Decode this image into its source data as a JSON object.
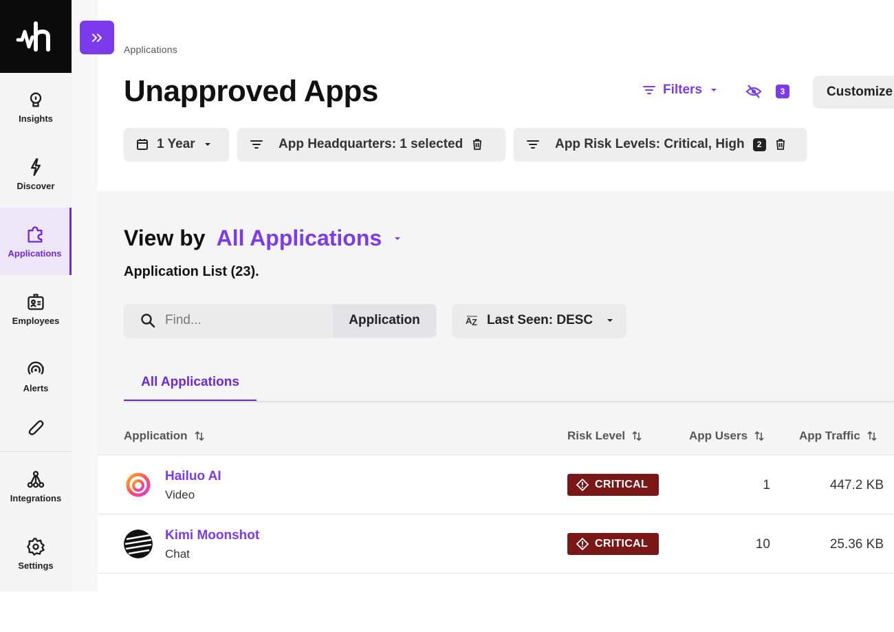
{
  "sidebar": {
    "items": [
      {
        "label": "Insights",
        "icon": "lightbulb-icon"
      },
      {
        "label": "Discover",
        "icon": "lightning-icon"
      },
      {
        "label": "Applications",
        "icon": "puzzle-icon",
        "active": true
      },
      {
        "label": "Employees",
        "icon": "id-badge-icon"
      },
      {
        "label": "Alerts",
        "icon": "broadcast-alert-icon"
      },
      {
        "label": "",
        "icon": "paperclip-icon"
      },
      {
        "label": "Integrations",
        "icon": "network-icon"
      },
      {
        "label": "Settings",
        "icon": "gear-icon"
      }
    ]
  },
  "header": {
    "breadcrumb": "Applications",
    "title": "Unapproved Apps",
    "filters_label": "Filters",
    "hidden_count": "3",
    "customize_label": "Customize"
  },
  "chips": [
    {
      "label": "1 Year"
    },
    {
      "label": "App Headquarters: 1 selected"
    },
    {
      "label": "App Risk Levels: Critical, High",
      "count": "2"
    }
  ],
  "content": {
    "view_by_label": "View by",
    "view_by_value": "All Applications",
    "list_count": "Application List (23).",
    "search_placeholder": "Find...",
    "search_scope": "Application",
    "sort_label": "Last Seen: DESC",
    "tab": "All Applications"
  },
  "table": {
    "columns": [
      "Application",
      "Risk Level",
      "App Users",
      "App Traffic"
    ],
    "rows": [
      {
        "name": "Hailuo AI",
        "category": "Video",
        "risk": "CRITICAL",
        "users": "1",
        "traffic": "447.2 KB"
      },
      {
        "name": "Kimi Moonshot",
        "category": "Chat",
        "risk": "CRITICAL",
        "users": "10",
        "traffic": "25.36 KB"
      }
    ]
  },
  "colors": {
    "accent": "#7c3aed",
    "critical": "#7a1818",
    "logo_bg": "#0b0b0b"
  }
}
